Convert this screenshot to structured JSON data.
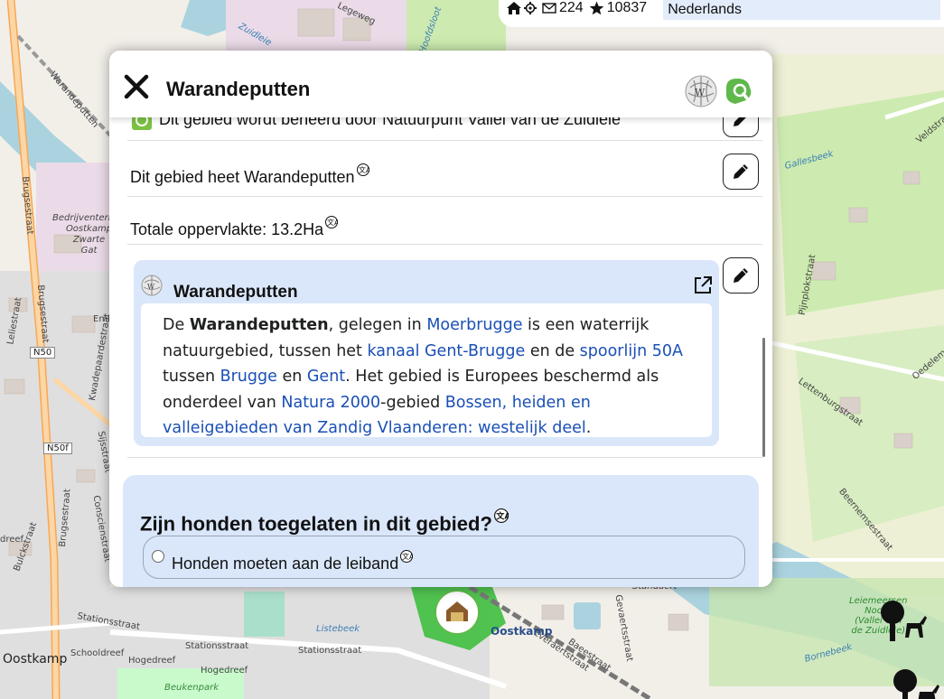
{
  "map": {
    "labels": {
      "legeweg": "Legeweg",
      "zuidleie": "Zuidleie",
      "hoofdsloot": "Hoofdsloot",
      "warandeputten_road": "Warandeputten",
      "bedrijventerrein": "Bedrijventerrein\nOostkamp\nZwarte\nGat",
      "brugsestraat_1": "Brugsestraat",
      "brugsestraat_2": "Brugsestraat",
      "brugsestraat_3": "Brugsestraat",
      "leliestraat": "Leliestraat",
      "kwadepaardestraat": "Kwadepaardestraat",
      "emiel": "Emiel",
      "sijsstraat": "Sijsstraat",
      "conscienstraat": "Conscienstraat",
      "bulckstraat": "Bulckstraat",
      "dreef": "dreef",
      "stationsstraat_1": "Stationsstraat",
      "stationsstraat_2": "Stationsstraat",
      "stationsstraat_3": "Stationsstraat",
      "schooldreef": "Schooldreef",
      "hogedreef_1": "Hogedreef",
      "hogedreef_2": "Hogedreef",
      "beukenpark": "Beukenpark",
      "listebeek": "Listebeek",
      "gallesbeek": "Gallesbeek",
      "velddstraat": "Veldstraat",
      "pijnplokstraat": "Pijnplokstraat",
      "lettenburgstraat": "Lettenburgstraat",
      "oedelemse": "Oedelemse",
      "beernemsestraat": "Beernemsestraat",
      "gevaertsstraat": "Gevaertsstraat",
      "baeestraat": "Baeestraat",
      "everaertstraat": "Everaertstraat",
      "standaert": "Standaert",
      "bornebeek": "Bornebeek",
      "leiemeersen": "Leiemeersen\nNoord\n(Vallei van\nde Zuidleie)"
    },
    "town": "Oostkamp",
    "station": "Oostkamp",
    "shields": {
      "n50": "N50",
      "n50f": "N50f"
    }
  },
  "topbar": {
    "home_icon": "home-icon",
    "settings_icon": "gear-icon",
    "messages_count": "224",
    "points_count": "10837",
    "search_value": "Nederlands"
  },
  "popup": {
    "title": "Warandeputten",
    "rows": {
      "managed_by": "Dit gebied wordt beheerd door Natuurpunt Vallei van de Zuidleie",
      "name": "Dit gebied heet Warandeputten",
      "area": "Totale oppervlakte: 13.2Ha"
    },
    "wikipedia": {
      "title": "Warandeputten",
      "article": {
        "p1": "De ",
        "bold": "Warandeputten",
        "p2": ", gelegen in ",
        "link_moerbrugge": "Moerbrugge",
        "p3": " is een waterrijk natuurgebied, tussen het ",
        "link_kanaal": "kanaal Gent-Brugge",
        "p4": " en de ",
        "link_spoorlijn": "spoorlijn 50A",
        "p5": " tussen ",
        "link_brugge": "Brugge",
        "p6": " en ",
        "link_gent": "Gent",
        "p7": ". Het gebied is Europees beschermd als onderdeel van ",
        "link_natura": "Natura 2000",
        "p8": "-gebied ",
        "link_bossen": "Bossen, heiden en valleigebieden van Zandig Vlaanderen: westelijk deel",
        "p9": "."
      }
    },
    "question": {
      "title": "Zijn honden toegelaten in dit gebied?",
      "options": [
        "Honden moeten aan de leiband"
      ]
    }
  },
  "colors": {
    "accent_blue": "#dae7fb",
    "link": "#1a4fb5",
    "nature_green": "#5fb84b"
  }
}
